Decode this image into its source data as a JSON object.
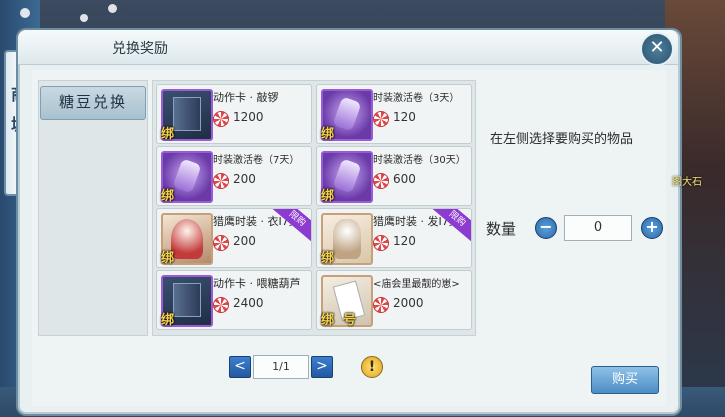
{
  "window": {
    "title": "兑换奖励",
    "close_icon": "close-icon"
  },
  "shop_banner": {
    "chars": [
      "商",
      "城"
    ]
  },
  "category": {
    "selected_label": "糖豆兑换"
  },
  "items": [
    {
      "name": "动作卡 · 敲锣",
      "price": "1200",
      "icon": "book-card-icon",
      "badge": "绑",
      "limited": false
    },
    {
      "name": "时装激活卷（3天）",
      "price": "120",
      "icon": "fashion-coupon-icon",
      "badge": "绑",
      "limited": false
    },
    {
      "name": "时装激活卷（7天）",
      "price": "200",
      "icon": "fashion-coupon-icon",
      "badge": "绑",
      "limited": false
    },
    {
      "name": "时装激活卷（30天）",
      "price": "600",
      "icon": "fashion-coupon-icon",
      "badge": "绑",
      "limited": false
    },
    {
      "name": "猎鹰时装 · 衣I7天",
      "price": "200",
      "icon": "hunter-outfit-icon",
      "badge": "绑",
      "limited": true
    },
    {
      "name": "猎鹰时装 · 发I7天",
      "price": "120",
      "icon": "hunter-hair-icon",
      "badge": "绑",
      "limited": true
    },
    {
      "name": "动作卡 · 喂糖葫芦",
      "price": "2400",
      "icon": "book-card-icon",
      "badge": "绑",
      "limited": false
    },
    {
      "name": "<庙会里最靓的崽>",
      "price": "2000",
      "icon": "title-scroll-icon",
      "badge": "绑",
      "badge2": "号",
      "limited": false
    }
  ],
  "limit_label": "限购",
  "pagination": {
    "page": "1/1",
    "prev_icon": "arrow-left-icon",
    "next_icon": "arrow-right-icon",
    "info_icon": "info-icon"
  },
  "detail": {
    "hint": "在左侧选择要购买的物品",
    "quantity_label": "数量",
    "quantity_value": "0",
    "buy_label": "购买"
  },
  "side_label": "图大石",
  "colors": {
    "accent": "#3b7fd0",
    "limited": "#8c3ad0",
    "panel": "#e9f0f2"
  }
}
